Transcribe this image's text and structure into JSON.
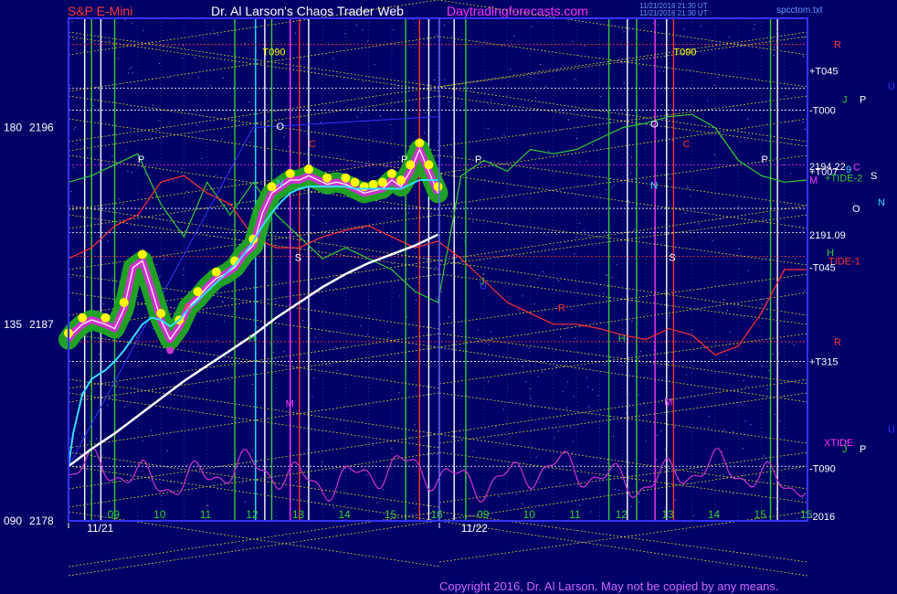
{
  "header": {
    "symbol": "S&P E-Mini",
    "title": "Dr. Al Larson's Chaos Trader Web",
    "site": "Daytradingforecasts.com",
    "stamp1": "11/21/2016 21:30 UT",
    "stamp2": "11/21/2016 21:30 UT",
    "file": "spcctom.txt"
  },
  "colors": {
    "background": "#000066",
    "plot_border": "#3333ff",
    "price_glow": "#22aa22",
    "price_dots": "#ffff00",
    "magenta": "#cc33cc",
    "cyan_avg": "#33ddff",
    "white_line": "#ffffff",
    "green_line": "#33cc33",
    "red_line": "#ff3333",
    "blue_line": "#3333ff"
  },
  "y_axis_labels": [
    {
      "left": "180",
      "right": "2196",
      "price": 2196
    },
    {
      "left": "135",
      "right": "2187",
      "price": 2187
    },
    {
      "left": "090",
      "right": "2178",
      "price": 2178
    }
  ],
  "price_labels": [
    {
      "text": "2194.22",
      "price": 2194.22
    },
    {
      "text": "2191.09",
      "price": 2191.09
    }
  ],
  "right_labels": [
    {
      "text": "R",
      "color": "#ff3333",
      "price": 2199.8
    },
    {
      "text": "+T045",
      "color": "#ffffff",
      "price": 2198.6
    },
    {
      "text": "U",
      "color": "#3333ff",
      "price": 2197.9
    },
    {
      "text": "J",
      "color": "#33cc33",
      "price": 2197.3
    },
    {
      "text": "P",
      "color": "#ffffff",
      "price": 2197.3
    },
    {
      "text": "-T000",
      "color": "#ffffff",
      "price": 2196.8
    },
    {
      "text": "C",
      "color": "#ff33ff",
      "price": 2194.2
    },
    {
      "text": "+T007",
      "color": "#ffffff",
      "price": 2194.0
    },
    {
      "text": "9",
      "color": "#33ddff",
      "price": 2194.1
    },
    {
      "text": "S",
      "color": "#ffffff",
      "price": 2193.8
    },
    {
      "text": "M",
      "color": "#ff33ff",
      "price": 2193.6
    },
    {
      "text": "+TIDE-2",
      "color": "#33cc33",
      "price": 2193.7
    },
    {
      "text": "N",
      "color": "#33ddff",
      "price": 2192.6
    },
    {
      "text": "O",
      "color": "#ffffff",
      "price": 2192.3
    },
    {
      "text": "H",
      "color": "#33cc33",
      "price": 2190.3
    },
    {
      "text": "TIDE-1",
      "color": "#ff3333",
      "price": 2189.9
    },
    {
      "text": "-T045",
      "color": "#ffffff",
      "price": 2189.6
    },
    {
      "text": "R",
      "color": "#ff3333",
      "price": 2186.2
    },
    {
      "text": "+T315",
      "color": "#ffffff",
      "price": 2185.3
    },
    {
      "text": "U",
      "color": "#3333ff",
      "price": 2182.2
    },
    {
      "text": "XTIDE",
      "color": "#ff33ff",
      "price": 2181.6
    },
    {
      "text": "J",
      "color": "#33cc33",
      "price": 2181.3
    },
    {
      "text": "P",
      "color": "#ffffff",
      "price": 2181.3
    },
    {
      "text": "-T090",
      "color": "#ffffff",
      "price": 2180.4
    },
    {
      "text": "-2016",
      "color": "#ffffff",
      "price": 2178.2
    }
  ],
  "x_axis": {
    "ticks": [
      {
        "t": 9,
        "label": "09"
      },
      {
        "t": 10,
        "label": "10"
      },
      {
        "t": 11,
        "label": "11"
      },
      {
        "t": 12,
        "label": "12"
      },
      {
        "t": 13,
        "label": "13"
      },
      {
        "t": 14,
        "label": "14"
      },
      {
        "t": 15,
        "label": "15"
      },
      {
        "t": 16,
        "label": "16"
      },
      {
        "t": 17,
        "label": "09"
      },
      {
        "t": 18,
        "label": "10"
      },
      {
        "t": 19,
        "label": "11"
      },
      {
        "t": 20,
        "label": "12"
      },
      {
        "t": 21,
        "label": "13"
      },
      {
        "t": 22,
        "label": "14"
      },
      {
        "t": 23,
        "label": "15"
      },
      {
        "t": 24,
        "label": "15"
      }
    ],
    "dates": [
      {
        "t": 8.4,
        "label": "11/21"
      },
      {
        "t": 16.5,
        "label": "11/22"
      }
    ]
  },
  "plot_letters": [
    {
      "text": "T090",
      "color": "#ffff00",
      "t": 12.2,
      "price": 2199.3
    },
    {
      "text": "T090",
      "color": "#ffff00",
      "t": 21.1,
      "price": 2199.3
    },
    {
      "text": "O",
      "color": "#ffffff",
      "t": 12.5,
      "price": 2195.9
    },
    {
      "text": "O",
      "color": "#ffffff",
      "t": 20.6,
      "price": 2196.0
    },
    {
      "text": "P",
      "color": "#ffffff",
      "t": 9.5,
      "price": 2194.4
    },
    {
      "text": "P",
      "color": "#ffffff",
      "t": 15.2,
      "price": 2194.4
    },
    {
      "text": "P",
      "color": "#ffffff",
      "t": 16.8,
      "price": 2194.4
    },
    {
      "text": "P",
      "color": "#ffffff",
      "t": 23.0,
      "price": 2194.4
    },
    {
      "text": "C",
      "color": "#ff3333",
      "t": 13.2,
      "price": 2195.1
    },
    {
      "text": "C",
      "color": "#ff3333",
      "t": 21.3,
      "price": 2195.1
    },
    {
      "text": "N",
      "color": "#33ddff",
      "t": 12.5,
      "price": 2193.3
    },
    {
      "text": "N",
      "color": "#33ddff",
      "t": 20.6,
      "price": 2193.2
    },
    {
      "text": "S",
      "color": "#ffffff",
      "t": 12.9,
      "price": 2189.9
    },
    {
      "text": "S",
      "color": "#ffffff",
      "t": 21.0,
      "price": 2189.9
    },
    {
      "text": "R",
      "color": "#ff3333",
      "t": 10.5,
      "price": 2187.6
    },
    {
      "text": "R",
      "color": "#ff3333",
      "t": 18.6,
      "price": 2187.6
    },
    {
      "text": "H",
      "color": "#33cc33",
      "t": 11.9,
      "price": 2186.2
    },
    {
      "text": "H",
      "color": "#33cc33",
      "t": 19.9,
      "price": 2186.2
    },
    {
      "text": "M",
      "color": "#ff33ff",
      "t": 12.7,
      "price": 2183.2
    },
    {
      "text": "M",
      "color": "#ff33ff",
      "t": 20.9,
      "price": 2183.3
    },
    {
      "text": "J",
      "color": "#33cc33",
      "t": 16.9,
      "price": 2188.8
    },
    {
      "text": "U",
      "color": "#3333ff",
      "t": 16.9,
      "price": 2188.6
    }
  ],
  "copyright": "Copyright 2016, Dr. Al Larson. May not be copied by any means.",
  "chart_data": {
    "type": "line",
    "title": "S&P E-Mini",
    "xlabel": "",
    "ylabel": "",
    "xlim": [
      8.0,
      24.0
    ],
    "ylim": [
      2178.0,
      2201.0
    ],
    "grid": true,
    "series": [
      {
        "x": [
          8.0,
          8.1,
          8.3,
          8.5,
          8.8,
          9.0,
          9.2,
          9.4,
          9.6,
          9.8,
          10.0,
          10.2,
          10.4,
          10.6,
          10.8,
          11.0,
          11.2,
          11.4,
          11.6,
          11.8,
          12.0,
          12.2,
          12.4,
          12.6,
          12.8,
          13.0,
          13.2,
          13.4,
          13.6,
          13.8,
          14.0,
          14.2,
          14.4,
          14.6,
          14.8,
          15.0,
          15.2,
          15.4,
          15.6,
          15.8,
          16.0
        ],
        "y": [
          2186.3,
          2186.6,
          2187.0,
          2187.2,
          2187.0,
          2186.8,
          2187.7,
          2189.6,
          2189.9,
          2188.6,
          2187.2,
          2186.3,
          2186.9,
          2187.8,
          2188.2,
          2188.7,
          2189.1,
          2189.3,
          2189.6,
          2190.2,
          2190.6,
          2192.1,
          2193.0,
          2193.3,
          2193.6,
          2193.6,
          2193.8,
          2193.6,
          2193.4,
          2193.5,
          2193.4,
          2193.2,
          2193.0,
          2193.1,
          2193.2,
          2193.6,
          2193.3,
          2194.0,
          2195.0,
          2194.0,
          2193.0
        ]
      },
      {
        "x": [
          8.0,
          8.1,
          8.3,
          8.5,
          8.8,
          9.0,
          9.2,
          9.4,
          9.6,
          9.8,
          10.0,
          10.2,
          10.4,
          10.6,
          10.8,
          11.0,
          11.2,
          11.4,
          11.6,
          11.8,
          12.0,
          12.2,
          12.4,
          12.6,
          12.8,
          13.0,
          13.2,
          13.4,
          13.6,
          13.8,
          14.0,
          14.2,
          14.4,
          14.6,
          14.8,
          15.0,
          15.2,
          15.4,
          15.6,
          15.8,
          16.0
        ],
        "y": [
          2180.5,
          2182.0,
          2183.8,
          2184.5,
          2184.9,
          2185.3,
          2185.8,
          2186.4,
          2187.0,
          2187.3,
          2187.2,
          2186.9,
          2187.2,
          2187.7,
          2188.1,
          2188.5,
          2188.9,
          2189.3,
          2189.7,
          2190.2,
          2190.8,
          2191.5,
          2192.1,
          2192.6,
          2193.0,
          2193.2,
          2193.3,
          2193.3,
          2193.3,
          2193.3,
          2193.3,
          2193.2,
          2193.2,
          2193.2,
          2193.2,
          2193.2,
          2193.2,
          2193.4,
          2193.6,
          2193.6,
          2193.6
        ]
      },
      {
        "x": [
          8.0,
          8.5,
          9.0,
          9.5,
          10.0,
          10.5,
          11.0,
          11.5,
          12.0,
          12.5,
          13.0,
          13.5,
          14.0,
          14.5,
          15.0,
          15.5,
          16.0
        ],
        "y": [
          2180.5,
          2181.3,
          2182.0,
          2182.8,
          2183.6,
          2184.4,
          2185.1,
          2185.8,
          2186.5,
          2187.3,
          2188.0,
          2188.7,
          2189.3,
          2189.8,
          2190.2,
          2190.6,
          2191.1
        ]
      },
      {
        "x": [
          8.0,
          8.5,
          9.0,
          9.5,
          10.0,
          10.5,
          11.0,
          11.5,
          12.0,
          12.5,
          13.0,
          13.5,
          14.0,
          14.5,
          15.0,
          15.5,
          16.0,
          16.5,
          17.0,
          17.5,
          18.0,
          18.5,
          19.0,
          19.5,
          20.0,
          20.5,
          21.0,
          21.5,
          22.0,
          22.5,
          23.0,
          23.5,
          24.0
        ],
        "y": [
          2193.5,
          2193.8,
          2194.3,
          2194.8,
          2192.5,
          2191.0,
          2193.5,
          2192.0,
          2193.5,
          2192.0,
          2191.0,
          2190.0,
          2190.5,
          2190.0,
          2189.5,
          2188.5,
          2188.0,
          2193.8,
          2194.5,
          2194.0,
          2195.0,
          2194.8,
          2195.0,
          2195.5,
          2196.0,
          2196.2,
          2196.5,
          2196.6,
          2196.0,
          2194.5,
          2193.8,
          2193.5,
          2193.6
        ]
      },
      {
        "x": [
          8.0,
          8.5,
          9.0,
          9.5,
          10.0,
          10.5,
          11.0,
          11.5,
          12.0,
          12.5,
          13.0,
          13.5,
          14.0,
          14.5,
          15.0,
          15.5,
          16.0,
          16.5,
          17.0,
          17.5,
          18.0,
          18.5,
          19.0,
          19.5,
          20.0,
          20.5,
          21.0,
          21.5,
          22.0,
          22.5,
          23.0,
          23.5,
          24.0
        ],
        "y": [
          2190.0,
          2190.5,
          2191.5,
          2192.0,
          2193.5,
          2193.8,
          2193.0,
          2192.5,
          2191.0,
          2190.5,
          2190.5,
          2191.0,
          2191.3,
          2191.5,
          2191.0,
          2190.5,
          2190.8,
          2190.0,
          2189.0,
          2188.0,
          2187.5,
          2187.0,
          2187.0,
          2186.8,
          2186.5,
          2186.3,
          2186.8,
          2186.5,
          2185.6,
          2186.0,
          2187.5,
          2189.5,
          2189.5
        ]
      }
    ]
  }
}
